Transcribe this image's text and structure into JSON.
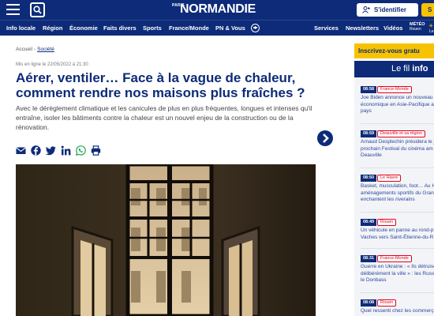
{
  "header": {
    "logo_prefix": "PARIS",
    "logo_main": "NORMANDIE",
    "signin_label": "S'identifier",
    "subscribe_label": "S"
  },
  "nav": {
    "items": [
      "Info locale",
      "Région",
      "Économie",
      "Faits divers",
      "Sports",
      "France/Monde",
      "PN & Vous"
    ],
    "right_items": [
      "Services",
      "Newsletters",
      "Vidéos"
    ],
    "meteo_label": "MÉTÉO",
    "meteo_city": "Rouen",
    "meteo_extra": "Le"
  },
  "article": {
    "breadcrumb": [
      "Accueil",
      "Société"
    ],
    "meta": "Mis en ligne le 22/05/2022 à 21:30",
    "title": "Aérer, ventiler… Face à la vague de chaleur, comment rendre nos maisons plus fraîches ?",
    "chapo": "Avec le dérèglement climatique et les canicules de plus en plus fréquentes, longues et intenses qu'il entraîne, isoler les bâtiments contre la chaleur est un nouvel enjeu de la construction ou de la rénovation."
  },
  "sidebar": {
    "promo": "Inscrivez-vous gratu",
    "fil_prefix": "Le fil ",
    "fil_bold": "info",
    "items": [
      {
        "time": "08:58",
        "tag": "France-Monde",
        "lines": [
          "Joe Biden annonce un nouveau p",
          "économique en Asie-Pacifique a",
          "pays"
        ]
      },
      {
        "time": "08:59",
        "tag": "Deauville et sa région",
        "lines": [
          "Arnaud Desplechin présidera le j",
          "prochain Festival du cinéma am",
          "Deauville"
        ]
      },
      {
        "time": "08:50",
        "tag": "Le Havre",
        "lines": [
          "Basket, musculation, foot… Au H",
          "aménagements sportifs du Gran",
          "enchantent les riverains"
        ]
      },
      {
        "time": "08:49",
        "tag": "Rouen",
        "lines": [
          "Un véhicule en panne au rond-p",
          "Vaches vers Saint-Étienne-du-R"
        ]
      },
      {
        "time": "08:31",
        "tag": "France-Monde",
        "lines": [
          "Guerre en Ukraine : « Ils détruise",
          "délibérément la ville » : les Russ",
          "le Donbass"
        ]
      },
      {
        "time": "08:08",
        "tag": "Rouen",
        "lines": [
          "Quel ressenti chez les commerça"
        ]
      }
    ]
  }
}
